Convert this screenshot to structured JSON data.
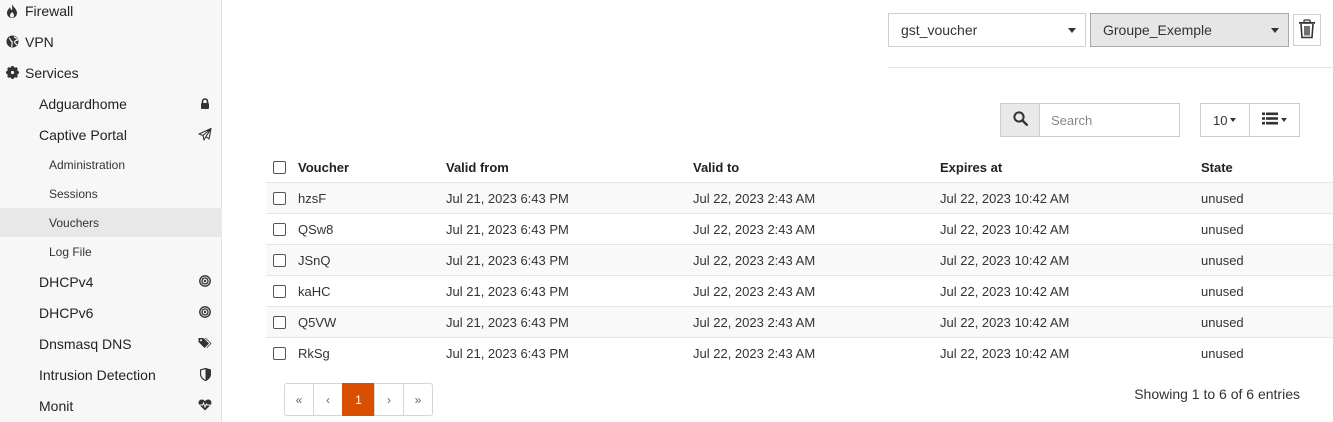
{
  "sidebar": {
    "firewall": "Firewall",
    "vpn": "VPN",
    "services": "Services",
    "adguardhome": "Adguardhome",
    "captive_portal": "Captive Portal",
    "administration": "Administration",
    "sessions": "Sessions",
    "vouchers": "Vouchers",
    "log_file": "Log File",
    "dhcpv4": "DHCPv4",
    "dhcpv6": "DHCPv6",
    "dnsmasq": "Dnsmasq DNS",
    "intrusion": "Intrusion Detection",
    "monit": "Monit"
  },
  "toolbar": {
    "provider_select": "gst_voucher",
    "group_select": "Groupe_Exemple",
    "search_placeholder": "Search",
    "page_size": "10"
  },
  "table": {
    "headers": [
      "Voucher",
      "Valid from",
      "Valid to",
      "Expires at",
      "State"
    ],
    "rows": [
      [
        "hzsF",
        "Jul 21, 2023 6:43 PM",
        "Jul 22, 2023 2:43 AM",
        "Jul 22, 2023 10:42 AM",
        "unused"
      ],
      [
        "QSw8",
        "Jul 21, 2023 6:43 PM",
        "Jul 22, 2023 2:43 AM",
        "Jul 22, 2023 10:42 AM",
        "unused"
      ],
      [
        "JSnQ",
        "Jul 21, 2023 6:43 PM",
        "Jul 22, 2023 2:43 AM",
        "Jul 22, 2023 10:42 AM",
        "unused"
      ],
      [
        "kaHC",
        "Jul 21, 2023 6:43 PM",
        "Jul 22, 2023 2:43 AM",
        "Jul 22, 2023 10:42 AM",
        "unused"
      ],
      [
        "Q5VW",
        "Jul 21, 2023 6:43 PM",
        "Jul 22, 2023 2:43 AM",
        "Jul 22, 2023 10:42 AM",
        "unused"
      ],
      [
        "RkSg",
        "Jul 21, 2023 6:43 PM",
        "Jul 22, 2023 2:43 AM",
        "Jul 22, 2023 10:42 AM",
        "unused"
      ]
    ]
  },
  "pagination": {
    "first": "«",
    "prev": "‹",
    "current": "1",
    "next": "›",
    "last": "»",
    "info": "Showing 1 to 6 of 6 entries"
  },
  "colors": {
    "accent": "#d94f00"
  }
}
